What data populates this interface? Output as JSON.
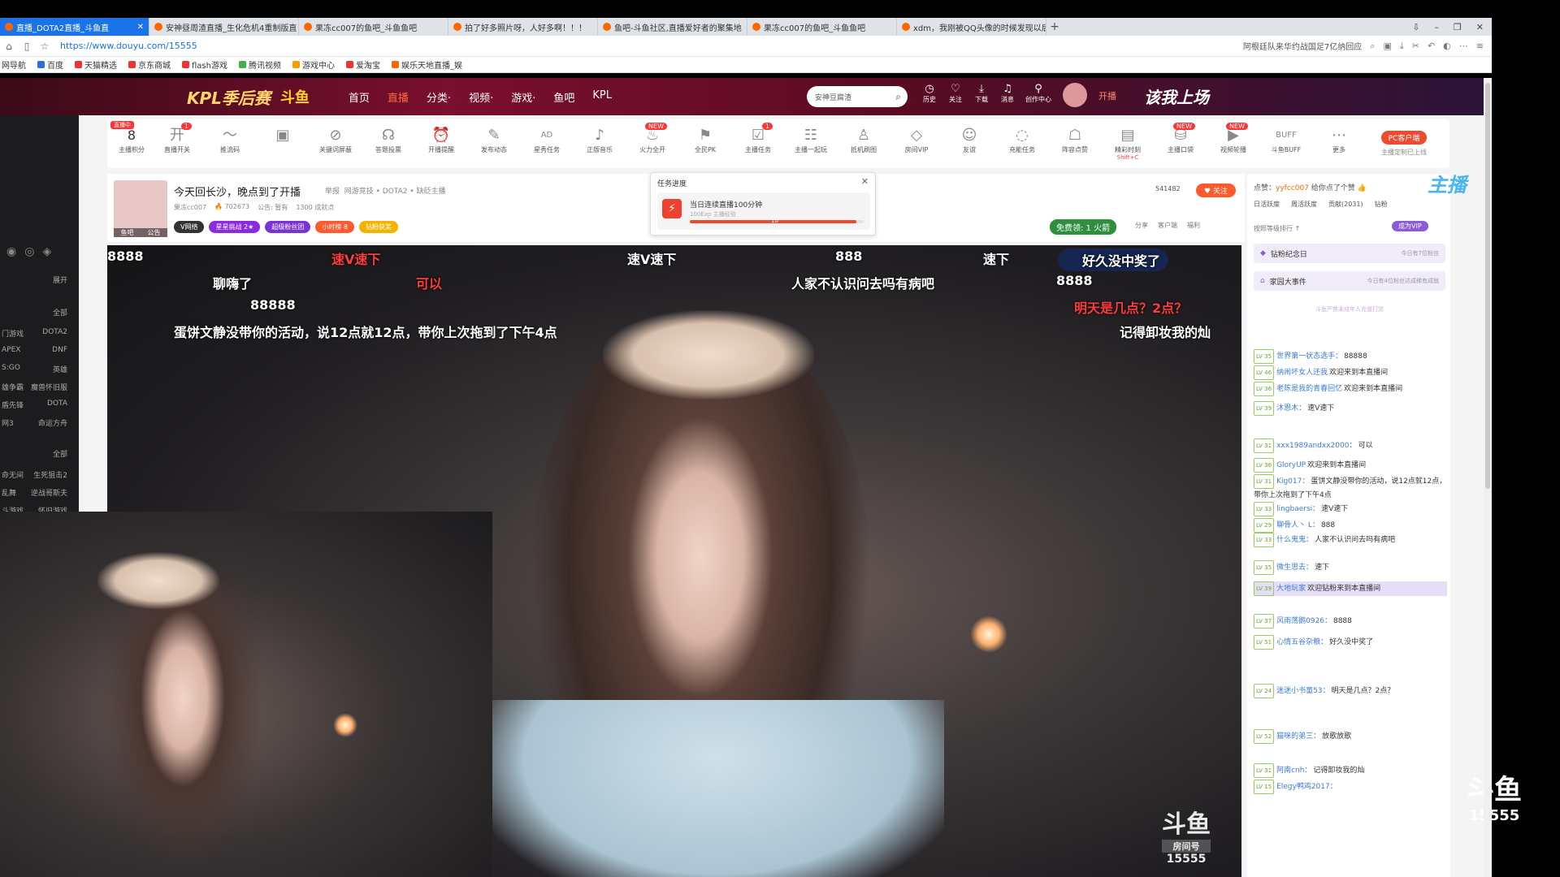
{
  "browser": {
    "tabs": [
      {
        "label": "直播_DOTA2直播_斗鱼直",
        "active": true
      },
      {
        "label": "安神昼周渣直播_生化危机4重制版直",
        "active": false
      },
      {
        "label": "果冻cc007的鱼吧_斗鱼鱼吧",
        "active": false
      },
      {
        "label": "拍了好多照片呀，人好多啊！！！",
        "active": false
      },
      {
        "label": "鱼吧-斗鱼社区,直播爱好者的聚集地",
        "active": false
      },
      {
        "label": "果冻cc007的鱼吧_斗鱼鱼吧",
        "active": false
      },
      {
        "label": "xdm，我刚被QQ头像的时候发现以后",
        "active": false
      }
    ],
    "new_tab": "+",
    "window_buttons": [
      "⇩",
      "–",
      "❐",
      "✕"
    ],
    "url": "https://www.douyu.com/15555",
    "address_right_text": "阿根廷队来华约战国足7亿纳回应",
    "bookmarks": [
      "网导航",
      "百度",
      "天猫精选",
      "京东商城",
      "flash游戏",
      "腾讯视频",
      "游戏中心",
      "爱淘宝",
      "娱乐天地直播_娱"
    ]
  },
  "header": {
    "kpl": "KPL季后赛",
    "logo": "斗鱼",
    "nav": [
      "首页",
      "直播",
      "分类·",
      "视频·",
      "游戏·",
      "鱼吧",
      "KPL"
    ],
    "active_nav": "直播",
    "search_placeholder": "安神豆腐渣",
    "icons": [
      "历史",
      "关注",
      "下载",
      "消息",
      "创作中心"
    ],
    "avatar_level": "30",
    "open_label": "开播",
    "lead_text": "该我上场"
  },
  "sidebar": {
    "more": "展开",
    "all1": "全部",
    "pairs": [
      [
        "门游戏",
        "DOTA2"
      ],
      [
        "APEX",
        "DNF"
      ],
      [
        "S:GO",
        "英雄"
      ],
      [
        "雄争霸",
        "魔兽怀旧服"
      ],
      [
        "盾先锋",
        "DOTA"
      ],
      [
        "网3",
        "命运方舟"
      ]
    ],
    "all2": "全部",
    "pairs2": [
      [
        "命无间",
        "生死狙击2"
      ],
      [
        "乱舞",
        "逆战哥斯夫"
      ],
      [
        "斗游戏",
        "怀旧游戏"
      ]
    ]
  },
  "toolbar": {
    "points_value": "8",
    "points_label": "主播积分",
    "points_badge": "直播中",
    "items": [
      {
        "icon": "开",
        "label": "直播开关",
        "badge": "1"
      },
      {
        "icon": "〜",
        "label": "推流码",
        "badge": ""
      },
      {
        "icon": "▣",
        "label": "",
        "badge": ""
      },
      {
        "icon": "⊘",
        "label": "关键词屏蔽",
        "badge": ""
      },
      {
        "icon": "☊",
        "label": "答题投票",
        "badge": ""
      },
      {
        "icon": "⏰",
        "label": "开播提醒",
        "badge": ""
      },
      {
        "icon": "✎",
        "label": "发布动态",
        "badge": ""
      },
      {
        "icon": "AD",
        "label": "星秀任务",
        "badge": ""
      },
      {
        "icon": "♪",
        "label": "正版音乐",
        "badge": ""
      },
      {
        "icon": "♨",
        "label": "火力全开",
        "badge": "NEW"
      },
      {
        "icon": "⚑",
        "label": "全民PK",
        "badge": ""
      },
      {
        "icon": "☑",
        "label": "主播任务",
        "badge": "1"
      },
      {
        "icon": "☷",
        "label": "主播一起玩",
        "badge": ""
      },
      {
        "icon": "♙",
        "label": "抵机刷图",
        "badge": ""
      },
      {
        "icon": "◇",
        "label": "房间VIP",
        "badge": ""
      },
      {
        "icon": "☺",
        "label": "友谊",
        "badge": ""
      },
      {
        "icon": "◌",
        "label": "充能任务",
        "badge": ""
      },
      {
        "icon": "☖",
        "label": "阵容点赞",
        "badge": ""
      },
      {
        "icon": "▤",
        "label": "精彩时刻",
        "sub": "Shift+C",
        "badge": ""
      },
      {
        "icon": "⛁",
        "label": "主播口袋",
        "badge": "NEW"
      },
      {
        "icon": "▶",
        "label": "视频轮播",
        "badge": "NEW"
      },
      {
        "icon": "BUFF",
        "label": "斗鱼BUFF",
        "badge": ""
      },
      {
        "icon": "⋯",
        "label": "更多",
        "badge": ""
      }
    ],
    "pc_client": "PC客户端",
    "pc_sub": "主播定制已上线"
  },
  "room": {
    "title": "今天回长沙，晚点到了开播",
    "report": "举报",
    "category": "网游竞技 • DOTA2 • 缺砭主播",
    "anchor": "果冻cc007",
    "hot": "702673",
    "notice": "公告: 暂有",
    "fans_line": "1300 成就点",
    "avatar_tags": [
      "鱼吧",
      "公告"
    ],
    "tags": [
      {
        "text": "V网络",
        "color": "#333"
      },
      {
        "text": "星星挑战 2★",
        "color": "#8a2be2"
      },
      {
        "text": "超级粉丝团",
        "color": "#7a33d6"
      },
      {
        "text": "小时榜 8",
        "color": "#ff5a2e"
      },
      {
        "text": "钻粉获奖",
        "color": "#f2b400"
      }
    ],
    "follow_count": "541482",
    "follow": "♥ 关注",
    "free_gift": "免费领: 1 火箭",
    "actions": [
      "分享",
      "客户端",
      "福利"
    ]
  },
  "task": {
    "title": "任务进度",
    "name": "当日连续直播100分钟",
    "exp": "100Exp 主播经验",
    "progress": 0.96,
    "progress_text": "10"
  },
  "danmaku": [
    {
      "text": "8888",
      "red": false
    },
    {
      "text": "速V速下",
      "red": true
    },
    {
      "text": "速V速下",
      "red": false
    },
    {
      "text": "888",
      "red": false
    },
    {
      "text": "速下",
      "red": false
    },
    {
      "text": "好久没中奖了",
      "red": false
    },
    {
      "text": "聊嗨了",
      "red": false
    },
    {
      "text": "可以",
      "red": true
    },
    {
      "text": "人家不认识问去吗有病吧",
      "red": false
    },
    {
      "text": "8888",
      "red": false
    },
    {
      "text": "88888",
      "red": false
    },
    {
      "text": "明天是几点？2点？",
      "red": true
    },
    {
      "text": "蛋饼文静没带你的活动，说12点就12点，带你上次拖到了下午4点",
      "red": false
    },
    {
      "text": "记得卸妆我的灿",
      "red": false
    }
  ],
  "watermark": {
    "logo": "斗鱼",
    "label": "房间号",
    "room": "15555"
  },
  "watermark2": {
    "logo": "斗鱼",
    "label": "房间号",
    "room": "15555"
  },
  "rank": {
    "sender_prefix": "点赞：",
    "sender_name": "yyfcc007",
    "sender_suffix": "给你点了个赞",
    "tabs": [
      "日活跃度",
      "周活跃度",
      "贡献(2031)",
      "钻粉"
    ],
    "filter": "按照等级排行 ↑",
    "member_badge": "成为VIP",
    "cards": [
      {
        "label": "钻粉纪念日",
        "right": "今日有7位粉丝"
      },
      {
        "label": "家园大事件",
        "right": "今日有4位粉丝达成稀有成就"
      }
    ],
    "notice": "斗鱼严禁未成年人充值打赏"
  },
  "chat": [
    {
      "lv": "LV 35",
      "name": "世界第一状态选手：",
      "text": "88888"
    },
    {
      "lv": "LV 46",
      "name": "纳闹坏女人还我",
      "text": "欢迎来到本直播间"
    },
    {
      "lv": "LV 36",
      "name": "老陈是我的青春回忆",
      "text": "欢迎来到本直播间"
    },
    {
      "lv": "LV 39",
      "name": "沐恩木：",
      "text": "速V速下"
    },
    {
      "lv": "LV 31",
      "name": "xxx1989andxx2000：",
      "text": "可以"
    },
    {
      "lv": "LV 36",
      "name": "GloryUP",
      "text": "欢迎来到本直播间"
    },
    {
      "lv": "LV 31",
      "name": "Kig017：",
      "text": "蛋饼文静没带你的活动，说12点就12点，带你上次拖到了下午4点"
    },
    {
      "lv": "LV 33",
      "name": "lingbaersi：",
      "text": "速V速下"
    },
    {
      "lv": "LV 29",
      "name": "聊骨人丶 L：",
      "text": "888"
    },
    {
      "lv": "LV 33",
      "name": "什么鬼鬼：",
      "text": "人家不认识问去吗有病吧"
    },
    {
      "lv": "LV 35",
      "name": "微生思去：",
      "text": "速下"
    },
    {
      "lv": "LV 39",
      "name": "大地玩家",
      "text": "欢迎钻粉来到本直播间"
    },
    {
      "lv": "LV 37",
      "name": "风雨荡鹅0926：",
      "text": "8888"
    },
    {
      "lv": "LV 51",
      "name": "心情五谷杂粮：",
      "text": "好久没中奖了"
    },
    {
      "lv": "LV 24",
      "name": "迷迷小书童53：",
      "text": "明天是几点？2点？"
    },
    {
      "lv": "LV 52",
      "name": "猫咪的弟三：",
      "text": "放歌放歌"
    },
    {
      "lv": "LV 31",
      "name": "阿南cnh：",
      "text": "记得卸妆我的灿"
    },
    {
      "lv": "LV 15",
      "name": "Elegy鸭鸡2017：",
      "text": ""
    }
  ],
  "bluehost": "主播"
}
